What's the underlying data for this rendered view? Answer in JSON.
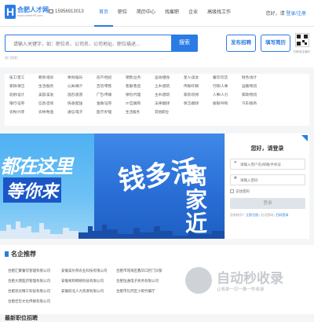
{
  "header": {
    "logo_letter": "H",
    "logo_name": "合肥人才网",
    "logo_url": "www.hefeiHR.com",
    "phone": "15956913013",
    "nav": [
      "首页",
      "职位",
      "简历中心",
      "找雇职",
      "企业",
      "高级找工作"
    ],
    "greeting": "您好，请",
    "login_register": "登录/注册"
  },
  "search": {
    "placeholder": "请输入关键字，如：职位名、公司名、公司地址、职位描述...",
    "button": "搜索",
    "hot_label": "热门搜索：",
    "post_job": "发布招聘",
    "fill_resume": "填写简历",
    "qr_label": "扫码关注我们"
  },
  "categories": [
    [
      "技工/普工",
      "教育/培训",
      "休闲/娱乐",
      "房产/经纪",
      "销售/业务",
      "运动/健身",
      "星人/美女",
      "餐饮/饮店",
      "财务/会计"
    ],
    [
      "家政/保洁",
      "生活/服务",
      "公关/媒介",
      "百货/零售",
      "客服/售后",
      "土木/建筑",
      "传媒/印刷",
      "行政/人事",
      "运输/物流"
    ],
    [
      "前厨/设计",
      "美容/美发",
      "酒店/旅游",
      "广告/传媒",
      "保险/代理",
      "主木/建筑",
      "家装/装修",
      "人事/人力",
      "家政/物流"
    ],
    [
      "银行/证券",
      "信息/咨询",
      "快递/配送",
      "金融/证券",
      "IT/互联网",
      "法律/翻译",
      "保洁/翻译",
      "收银/导购",
      "汽车/服务"
    ],
    [
      "农牧/兴菲",
      "农林/牧渔",
      "通信/电子",
      "医疗/护理",
      "生活服务",
      "其他职位"
    ]
  ],
  "banner": {
    "line1": "都在这里",
    "line2": "等你来",
    "right1": "钱多活",
    "right2": "离家近"
  },
  "login": {
    "title": "您好，请登录",
    "user_placeholder": "请输入用户名/邮箱/手机号",
    "pass_placeholder": "请输入密码",
    "remember": "记住密码",
    "submit": "登录",
    "no_account": "没有账号？",
    "register": "立即注册",
    "forgot": "忘记密码",
    "qr_login": "扫码登录"
  },
  "corporations": {
    "title": "名企推荐",
    "rows": [
      [
        "合肥汇聚餐饮管理有限公司",
        "安徽美尔邦农业科技有限公司",
        "合肥市瑶海区鑫华口腔门诊部"
      ],
      [
        "合肥大唐医药管理有限公司",
        "安徽易和网络科技有限公司",
        "合肥恒通电子商务有限公司"
      ],
      [
        "合肥思达精工科技有限公司",
        "安徽皖北人力资源有限公司",
        "合肥市包河区小雨竹餐厅"
      ],
      [
        "合肥佳哲文化传媒有限公司"
      ]
    ],
    "next_title": "最新职位招聘"
  },
  "watermark": {
    "title": "自动秒收录",
    "subtitle": "让收录一切一推一秒收录"
  }
}
